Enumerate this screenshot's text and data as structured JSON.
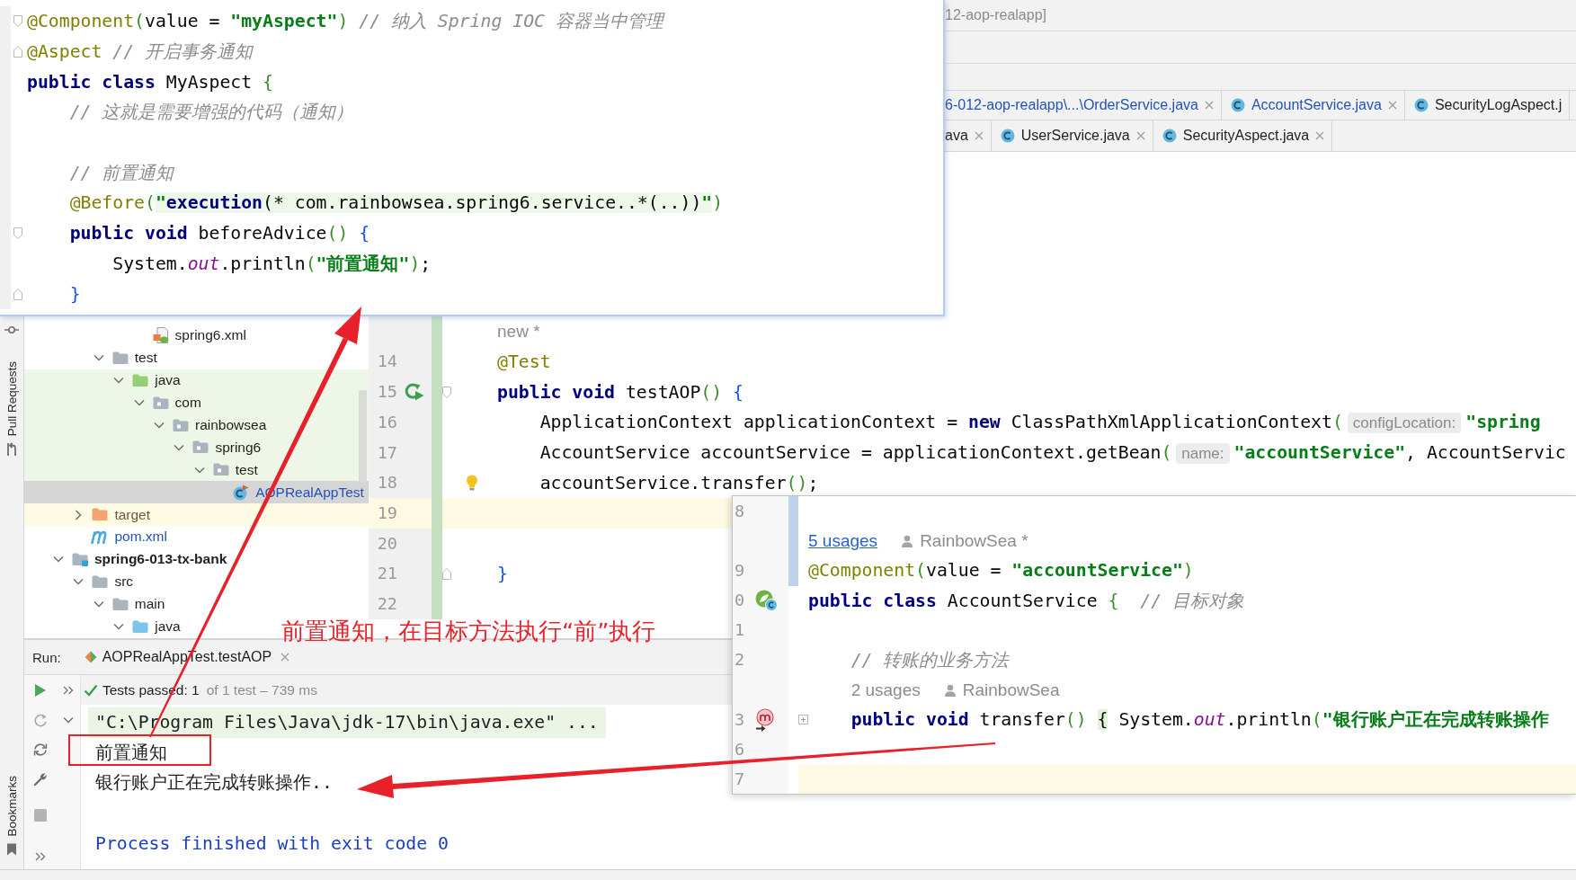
{
  "title_bar": {
    "title": "12-aop-realapp]"
  },
  "tab_rows": [
    {
      "tabs": [
        {
          "label": "6-012-aop-realapp\\...\\OrderService.java",
          "class_icon": false,
          "modified": true,
          "close_button": true
        },
        {
          "label": "AccountService.java",
          "class_icon": true,
          "modified": true,
          "close_button": true
        },
        {
          "label": "SecurityLogAspect.j",
          "class_icon": true,
          "modified": false,
          "close_button": false
        }
      ]
    },
    {
      "tabs": [
        {
          "label": "ava",
          "class_icon": false,
          "modified": false,
          "close_button": true
        },
        {
          "label": "UserService.java",
          "class_icon": true,
          "modified": false,
          "close_button": true
        },
        {
          "label": "SecurityAspect.java",
          "class_icon": true,
          "modified": false,
          "close_button": true
        }
      ]
    }
  ],
  "aspect_popup": {
    "blocks": [
      {
        "lines": [
          {
            "kind": "code",
            "fold": {
              "kind": "start"
            },
            "tokens": [
              {
                "kind": "annotation",
                "text": "@Component"
              },
              {
                "kind": "bracket",
                "text": "("
              },
              {
                "kind": "plain",
                "text": "value = "
              },
              {
                "kind": "string",
                "text": "\"myAspect\""
              },
              {
                "kind": "bracket",
                "text": ")"
              },
              {
                "kind": "comment",
                "text": " // 纳入 Spring IOC 容器当中管理"
              }
            ]
          },
          {
            "kind": "code",
            "fold": {
              "kind": "end"
            },
            "tokens": [
              {
                "kind": "annotation",
                "text": "@Aspect"
              },
              {
                "kind": "comment",
                "text": " // 开启事务通知"
              }
            ]
          },
          {
            "kind": "code",
            "tokens": [
              {
                "kind": "keyword",
                "text": "public class"
              },
              {
                "kind": "plain",
                "text": " MyAspect "
              },
              {
                "kind": "bracket",
                "text": "{"
              }
            ]
          },
          {
            "kind": "code",
            "tokens": [
              {
                "kind": "comment",
                "text": "    // 这就是需要增强的代码（通知）"
              }
            ]
          },
          {
            "kind": "blank"
          },
          {
            "kind": "code",
            "tokens": [
              {
                "kind": "comment",
                "text": "    // 前置通知"
              }
            ]
          },
          {
            "kind": "code",
            "tokens": [
              {
                "kind": "annotation",
                "text": "    @Before"
              },
              {
                "kind": "bracket",
                "text": "("
              },
              {
                "kind": "injected_quote",
                "text": "\""
              },
              {
                "kind": "injected_keyword",
                "text": "execution"
              },
              {
                "kind": "injected_text",
                "text": "(* com.rainbowsea.spring6.service..*(..))"
              },
              {
                "kind": "injected_quote",
                "text": "\""
              },
              {
                "kind": "bracket",
                "text": ")"
              }
            ]
          },
          {
            "kind": "code",
            "fold": {
              "kind": "start"
            },
            "tokens": [
              {
                "kind": "keyword",
                "text": "    public void"
              },
              {
                "kind": "plain",
                "text": " beforeAdvice"
              },
              {
                "kind": "bracket",
                "text": "() "
              },
              {
                "kind": "block_bracket",
                "text": "{"
              }
            ]
          },
          {
            "kind": "code",
            "tokens": [
              {
                "kind": "plain",
                "text": "        System."
              },
              {
                "kind": "field",
                "text": "out"
              },
              {
                "kind": "plain",
                "text": ".println"
              },
              {
                "kind": "bracket",
                "text": "("
              },
              {
                "kind": "string",
                "text": "\"前置通知\""
              },
              {
                "kind": "bracket",
                "text": ")"
              },
              {
                "kind": "plain",
                "text": ";"
              }
            ]
          },
          {
            "kind": "code",
            "fold": {
              "kind": "end"
            },
            "tokens": [
              {
                "kind": "block_bracket",
                "text": "    }"
              }
            ]
          }
        ]
      }
    ]
  },
  "side_toolbar": {
    "upper": "Pull Requests",
    "lower": "Bookmarks"
  },
  "project_tree": [
    {
      "children": [
        {
          "children": [
            {
              "children": [
                {
                  "children": [
                    {
                      "label": "spring6.xml",
                      "kind": "xml",
                      "selected": false,
                      "modified": false,
                      "test_scope": false,
                      "excluded": false
                    }
                  ]
                }
              ]
            },
            {
              "label": "test",
              "kind": "folder",
              "expanded": true,
              "selected": false,
              "modified": false,
              "test_scope": false,
              "excluded": false,
              "children": [
                {
                  "label": "java",
                  "kind": "test_root",
                  "expanded": true,
                  "selected": false,
                  "modified": false,
                  "test_scope": true,
                  "excluded": false,
                  "children": [
                    {
                      "label": "com",
                      "kind": "package",
                      "expanded": true,
                      "selected": false,
                      "modified": false,
                      "test_scope": true,
                      "excluded": false,
                      "children": [
                        {
                          "label": "rainbowsea",
                          "kind": "package",
                          "expanded": true,
                          "selected": false,
                          "modified": false,
                          "test_scope": true,
                          "excluded": false,
                          "children": [
                            {
                              "label": "spring6",
                              "kind": "package",
                              "expanded": true,
                              "selected": false,
                              "modified": false,
                              "test_scope": true,
                              "excluded": false,
                              "children": [
                                {
                                  "label": "test",
                                  "kind": "package",
                                  "expanded": true,
                                  "selected": false,
                                  "modified": false,
                                  "test_scope": true,
                                  "excluded": false,
                                  "children": [
                                    {
                                      "label": "AOPRealAppTest",
                                      "kind": "test_class",
                                      "selected": true,
                                      "modified": true,
                                      "test_scope": true,
                                      "excluded": false
                                    }
                                  ]
                                }
                              ]
                            }
                          ]
                        }
                      ]
                    }
                  ]
                }
              ]
            }
          ]
        },
        {
          "label": "target",
          "kind": "excluded",
          "expanded": false,
          "selected": false,
          "modified": false,
          "test_scope": false,
          "excluded": true
        },
        {
          "label": "pom.xml",
          "kind": "maven",
          "selected": false,
          "modified": true,
          "test_scope": false,
          "excluded": false
        }
      ]
    },
    {
      "label": "spring6-013-tx-bank",
      "kind": "module",
      "expanded": true,
      "selected": false,
      "modified": false,
      "test_scope": false,
      "excluded": false,
      "children": [
        {
          "label": "src",
          "kind": "folder",
          "expanded": true,
          "selected": false,
          "modified": false,
          "test_scope": false,
          "excluded": false,
          "children": [
            {
              "label": "main",
              "kind": "folder",
              "expanded": true,
              "selected": false,
              "modified": false,
              "test_scope": false,
              "excluded": false,
              "children": [
                {
                  "label": "java",
                  "kind": "source_root",
                  "expanded": true,
                  "selected": false,
                  "modified": false,
                  "test_scope": false,
                  "excluded": false
                }
              ]
            }
          ]
        }
      ]
    }
  ],
  "editor": {
    "blocks": [
      {
        "added": true,
        "lines": [
          {
            "kind": "hint",
            "author": "new *",
            "author_icon": false,
            "current": false
          },
          {
            "kind": "code",
            "number": "14",
            "current": false,
            "tokens": [
              {
                "kind": "annotation",
                "text": "@Test"
              }
            ]
          },
          {
            "kind": "code",
            "number": "15",
            "gutter": {
              "kind": "run"
            },
            "fold": {
              "kind": "start"
            },
            "current": false,
            "tokens": [
              {
                "kind": "keyword",
                "text": "public void"
              },
              {
                "kind": "plain",
                "text": " testAOP"
              },
              {
                "kind": "bracket",
                "text": "() "
              },
              {
                "kind": "block_bracket",
                "text": "{"
              }
            ]
          },
          {
            "kind": "code",
            "number": "16",
            "current": false,
            "tokens": [
              {
                "kind": "plain",
                "text": "    ApplicationContext applicationContext = "
              },
              {
                "kind": "keyword",
                "text": "new"
              },
              {
                "kind": "plain",
                "text": " ClassPathXmlApplicationContext"
              },
              {
                "kind": "bracket",
                "text": "("
              },
              {
                "kind": "param",
                "text": "configLocation:"
              },
              {
                "kind": "string",
                "text": "\"spring"
              }
            ]
          },
          {
            "kind": "code",
            "number": "17",
            "current": false,
            "tokens": [
              {
                "kind": "plain",
                "text": "    AccountService accountService = applicationContext.getBean"
              },
              {
                "kind": "bracket",
                "text": "("
              },
              {
                "kind": "param",
                "text": "name:"
              },
              {
                "kind": "string",
                "text": "\"accountService\""
              },
              {
                "kind": "plain",
                "text": ", AccountServic"
              }
            ]
          },
          {
            "kind": "code",
            "number": "18",
            "intention": true,
            "current": false,
            "tokens": [
              {
                "kind": "plain",
                "text": "    accountService.transfer"
              },
              {
                "kind": "bracket",
                "text": "()"
              },
              {
                "kind": "plain",
                "text": ";"
              }
            ]
          },
          {
            "kind": "blank",
            "number": "19",
            "current": true
          },
          {
            "kind": "blank",
            "number": "20",
            "current": false
          },
          {
            "kind": "code",
            "number": "21",
            "fold": {
              "kind": "end"
            },
            "current": false,
            "tokens": [
              {
                "kind": "block_bracket",
                "text": "}"
              }
            ]
          },
          {
            "kind": "blank",
            "number": "22",
            "current": false
          }
        ]
      }
    ]
  },
  "service_popup": {
    "blocks": [
      {
        "modified": true,
        "lines": [
          {
            "kind": "blank",
            "number": "8",
            "current": false
          },
          {
            "kind": "hint",
            "usages": "5 usages",
            "hovered": true,
            "author": "RainbowSea *",
            "author_icon": true,
            "current": false
          },
          {
            "kind": "code",
            "number": "9",
            "current": false,
            "tokens": [
              {
                "kind": "annotation",
                "text": "@Component"
              },
              {
                "kind": "bracket",
                "text": "("
              },
              {
                "kind": "plain",
                "text": "value = "
              },
              {
                "kind": "string",
                "text": "\"accountService\""
              },
              {
                "kind": "bracket",
                "text": ")"
              }
            ]
          }
        ]
      },
      {
        "modified": false,
        "lines": [
          {
            "kind": "code",
            "number": "0",
            "gutter": {
              "kind": "bean"
            },
            "current": false,
            "tokens": [
              {
                "kind": "keyword",
                "text": "public class"
              },
              {
                "kind": "plain",
                "text": " AccountService "
              },
              {
                "kind": "bracket",
                "text": "{"
              },
              {
                "kind": "comment",
                "text": "  // 目标对象"
              }
            ]
          },
          {
            "kind": "blank",
            "number": "1",
            "current": false
          },
          {
            "kind": "code",
            "number": "2",
            "current": false,
            "tokens": [
              {
                "kind": "comment",
                "text": "    // 转账的业务方法"
              }
            ]
          },
          {
            "kind": "hint",
            "usages": "    2 usages",
            "hovered": false,
            "author": "RainbowSea",
            "author_icon": true,
            "current": false
          },
          {
            "kind": "code",
            "number": "3",
            "gutter": {
              "kind": "method"
            },
            "fold": {
              "kind": "collapsed"
            },
            "current": false,
            "tokens": [
              {
                "kind": "keyword",
                "text": "    public void"
              },
              {
                "kind": "plain",
                "text": " transfer"
              },
              {
                "kind": "bracket",
                "text": "() "
              },
              {
                "kind": "brace_match",
                "text": "{"
              },
              {
                "kind": "plain",
                "text": " System."
              },
              {
                "kind": "field",
                "text": "out"
              },
              {
                "kind": "plain",
                "text": ".println"
              },
              {
                "kind": "bracket",
                "text": "("
              },
              {
                "kind": "string",
                "text": "\"银行账户正在完成转账操作"
              }
            ]
          },
          {
            "kind": "blank",
            "number": "6",
            "current": false
          },
          {
            "kind": "blank",
            "number": "7",
            "current": true
          }
        ]
      }
    ]
  },
  "run_panel": {
    "title": "Run:",
    "tab": {
      "label": "AOPRealAppTest.testAOP"
    },
    "status": {
      "summary": "Tests passed: 1",
      "detail": "of 1 test – 739 ms"
    },
    "console": [
      {
        "kind": "command",
        "text": "\"C:\\Program Files\\Java\\jdk-17\\bin\\java.exe\" ..."
      },
      {
        "kind": "output",
        "text": "前置通知"
      },
      {
        "kind": "output",
        "text": "银行账户正在完成转账操作.."
      },
      {
        "kind": "exit",
        "text": "Process finished with exit code 0"
      }
    ]
  },
  "annotation": {
    "note": "前置通知，在目标方法执行“前”执行"
  }
}
